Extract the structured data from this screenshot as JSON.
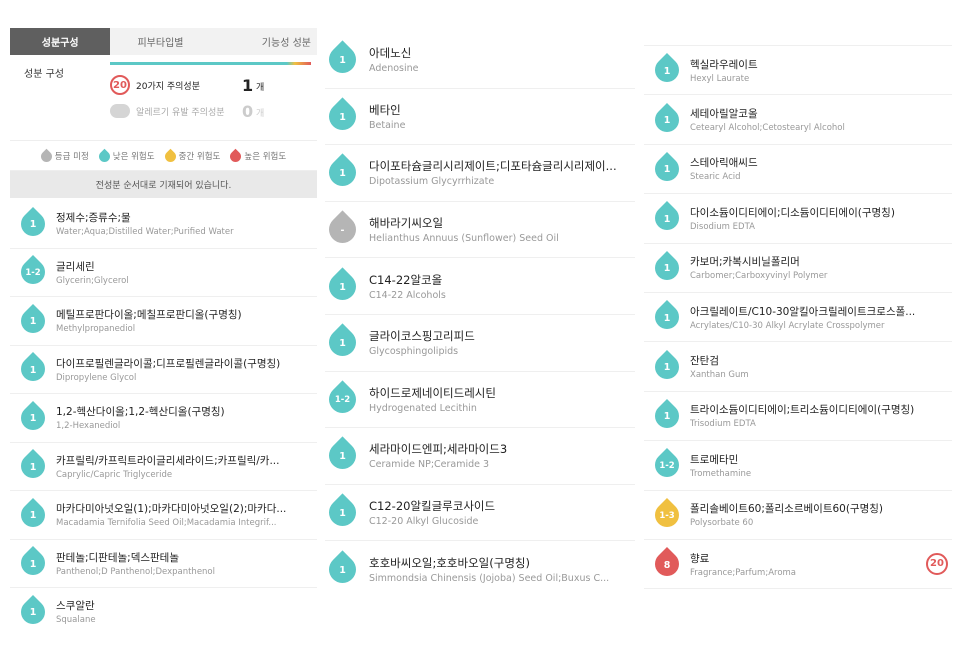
{
  "colors": {
    "teal": "#5cc8c6",
    "yellow": "#f0c040",
    "red": "#e15a5a",
    "gray": "#b5b5b5"
  },
  "tabs": [
    "성분구성",
    "피부타입별",
    "기능성 성분"
  ],
  "summary": {
    "label": "성분 구성",
    "caution20_label": "20가지 주의성분",
    "caution20_count": "1",
    "allergy_label": "알레르기 유발 주의성분",
    "allergy_count": "0",
    "unit": "개",
    "badge": "20"
  },
  "legend": [
    {
      "label": "등급 미정",
      "color": "gray"
    },
    {
      "label": "낮은 위험도",
      "color": "teal"
    },
    {
      "label": "중간 위험도",
      "color": "yellow"
    },
    {
      "label": "높은 위험도",
      "color": "red"
    }
  ],
  "notice": "전성분 순서대로 기재되어 있습니다.",
  "col1": [
    {
      "lvl": "1",
      "color": "teal",
      "ko": "정제수;증류수;물",
      "en": "Water;Aqua;Distilled Water;Purified Water"
    },
    {
      "lvl": "1-2",
      "color": "teal",
      "ko": "글리세린",
      "en": "Glycerin;Glycerol"
    },
    {
      "lvl": "1",
      "color": "teal",
      "ko": "메틸프로판다이올;메칠프로판디올(구명칭)",
      "en": "Methylpropanediol"
    },
    {
      "lvl": "1",
      "color": "teal",
      "ko": "다이프로필렌글라이콜;디프로필렌글라이콜(구명칭)",
      "en": "Dipropylene Glycol"
    },
    {
      "lvl": "1",
      "color": "teal",
      "ko": "1,2-헥산다이올;1,2-헥산디올(구명칭)",
      "en": "1,2-Hexanediol"
    },
    {
      "lvl": "1",
      "color": "teal",
      "ko": "카프릴릭/카프릭트라이글리세라이드;카프릴릭/카...",
      "en": "Caprylic/Capric Triglyceride"
    },
    {
      "lvl": "1",
      "color": "teal",
      "ko": "마카다미아넛오일(1);마카다미아넛오일(2);마카다...",
      "en": "Macadamia Ternifolia Seed Oil;Macadamia Integrif..."
    },
    {
      "lvl": "1",
      "color": "teal",
      "ko": "판테놀;디판테놀;덱스판테놀",
      "en": "Panthenol;D Panthenol;Dexpanthenol"
    },
    {
      "lvl": "1",
      "color": "teal",
      "ko": "스쿠알란",
      "en": "Squalane"
    }
  ],
  "col2": [
    {
      "lvl": "1",
      "color": "teal",
      "ko": "아데노신",
      "en": "Adenosine"
    },
    {
      "lvl": "1",
      "color": "teal",
      "ko": "베타인",
      "en": "Betaine"
    },
    {
      "lvl": "1",
      "color": "teal",
      "ko": "다이포타슘글리시리제이트;디포타슘글리시리제이...",
      "en": "Dipotassium Glycyrrhizate"
    },
    {
      "lvl": "-",
      "color": "gray",
      "ko": "해바라기씨오일",
      "en": "Helianthus Annuus (Sunflower) Seed Oil"
    },
    {
      "lvl": "1",
      "color": "teal",
      "ko": "C14-22알코올",
      "en": "C14-22 Alcohols"
    },
    {
      "lvl": "1",
      "color": "teal",
      "ko": "글라이코스핑고리피드",
      "en": "Glycosphingolipids"
    },
    {
      "lvl": "1-2",
      "color": "teal",
      "ko": "하이드로제네이티드레시틴",
      "en": "Hydrogenated Lecithin"
    },
    {
      "lvl": "1",
      "color": "teal",
      "ko": "세라마이드엔피;세라마이드3",
      "en": "Ceramide NP;Ceramide 3"
    },
    {
      "lvl": "1",
      "color": "teal",
      "ko": "C12-20알킬글루코사이드",
      "en": "C12-20 Alkyl Glucoside"
    },
    {
      "lvl": "1",
      "color": "teal",
      "ko": "호호바씨오일;호호바오일(구명칭)",
      "en": "Simmondsia Chinensis (Jojoba) Seed Oil;Buxus C..."
    }
  ],
  "col3": [
    {
      "lvl": "1",
      "color": "teal",
      "ko": "헥실라우레이트",
      "en": "Hexyl Laurate"
    },
    {
      "lvl": "1",
      "color": "teal",
      "ko": "세테아릴알코올",
      "en": "Cetearyl Alcohol;Cetostearyl Alcohol"
    },
    {
      "lvl": "1",
      "color": "teal",
      "ko": "스테아릭애씨드",
      "en": "Stearic Acid"
    },
    {
      "lvl": "1",
      "color": "teal",
      "ko": "다이소듐이디티에이;디소듐이디티에이(구명칭)",
      "en": "Disodium EDTA"
    },
    {
      "lvl": "1",
      "color": "teal",
      "ko": "카보머;카복시비닐폴리머",
      "en": "Carbomer;Carboxyvinyl Polymer"
    },
    {
      "lvl": "1",
      "color": "teal",
      "ko": "아크릴레이트/C10-30알킬아크릴레이트크로스폴...",
      "en": "Acrylates/C10-30 Alkyl Acrylate Crosspolymer"
    },
    {
      "lvl": "1",
      "color": "teal",
      "ko": "잔탄검",
      "en": "Xanthan Gum"
    },
    {
      "lvl": "1",
      "color": "teal",
      "ko": "트라이소듐이디티에이;트리소듐이디티에이(구명칭)",
      "en": "Trisodium EDTA"
    },
    {
      "lvl": "1-2",
      "color": "teal",
      "ko": "트로메타민",
      "en": "Tromethamine"
    },
    {
      "lvl": "1-3",
      "color": "yellow",
      "ko": "폴리솔베이트60;폴리소르베이트60(구명칭)",
      "en": "Polysorbate 60"
    },
    {
      "lvl": "8",
      "color": "red",
      "ko": "향료",
      "en": "Fragrance;Parfum;Aroma",
      "warn": "20"
    }
  ]
}
